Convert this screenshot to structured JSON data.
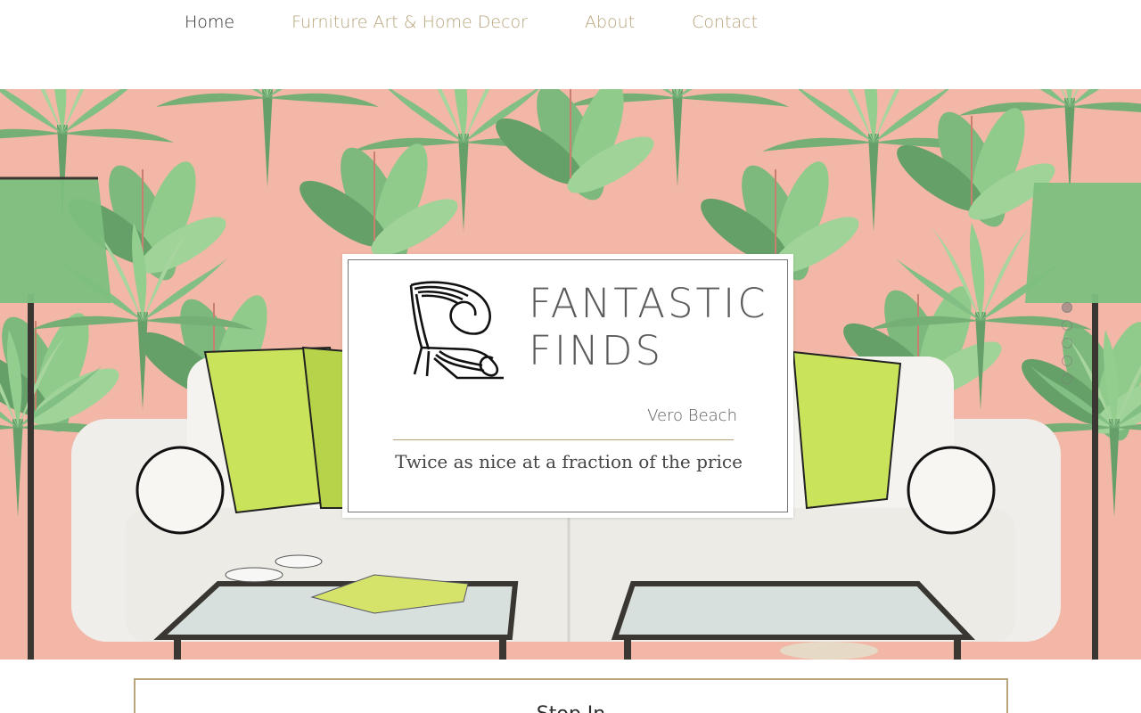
{
  "nav": {
    "items": [
      {
        "label": "Home",
        "active": true
      },
      {
        "label": "Furniture Art & Home Decor",
        "active": false
      },
      {
        "label": "About",
        "active": false
      },
      {
        "label": "Contact",
        "active": false
      }
    ]
  },
  "hero": {
    "brand_line1": "FANTASTIC",
    "brand_line2": "FINDS",
    "location": "Vero Beach",
    "tagline": "Twice as nice at a fraction of the price",
    "slide_count": 5,
    "active_slide": 1
  },
  "stop_section": {
    "title": "Stop In"
  },
  "colors": {
    "accent": "#b7a47a",
    "nav_active": "#2d2d2d",
    "wallpaper_bg": "#f2b7a6",
    "leaf": "#6fae73"
  }
}
